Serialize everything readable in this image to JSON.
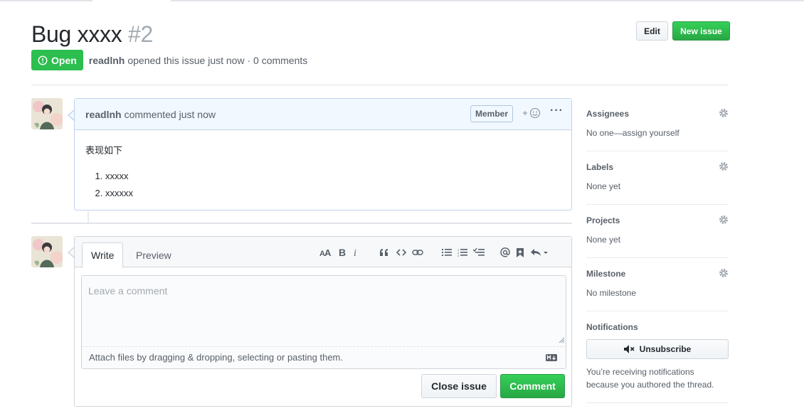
{
  "issue": {
    "title": "Bug xxxx",
    "number": "#2",
    "state": "Open",
    "author": "readlnh",
    "opened_text": "opened this issue just now · 0 comments"
  },
  "header": {
    "edit_label": "Edit",
    "new_issue_label": "New issue"
  },
  "comment": {
    "author": "readlnh",
    "meta": "commented just now",
    "badge": "Member",
    "body_intro": "表现如下",
    "items": [
      "xxxxx",
      "xxxxxx"
    ]
  },
  "editor": {
    "tab_write": "Write",
    "tab_preview": "Preview",
    "placeholder": "Leave a comment",
    "attach_hint": "Attach files by dragging & dropping, selecting or pasting them.",
    "close_label": "Close issue",
    "comment_label": "Comment"
  },
  "sidebar": {
    "assignees": {
      "label": "Assignees",
      "value": "No one—assign yourself"
    },
    "labels": {
      "label": "Labels",
      "value": "None yet"
    },
    "projects": {
      "label": "Projects",
      "value": "None yet"
    },
    "milestone": {
      "label": "Milestone",
      "value": "No milestone"
    },
    "notifications": {
      "label": "Notifications",
      "button": "Unsubscribe",
      "text": "You’re receiving notifications because you authored the thread."
    }
  },
  "colors": {
    "open_green": "#2cbe4e",
    "accent_blue": "#c0d3eb",
    "comment_head_bg": "#f1f8ff"
  }
}
